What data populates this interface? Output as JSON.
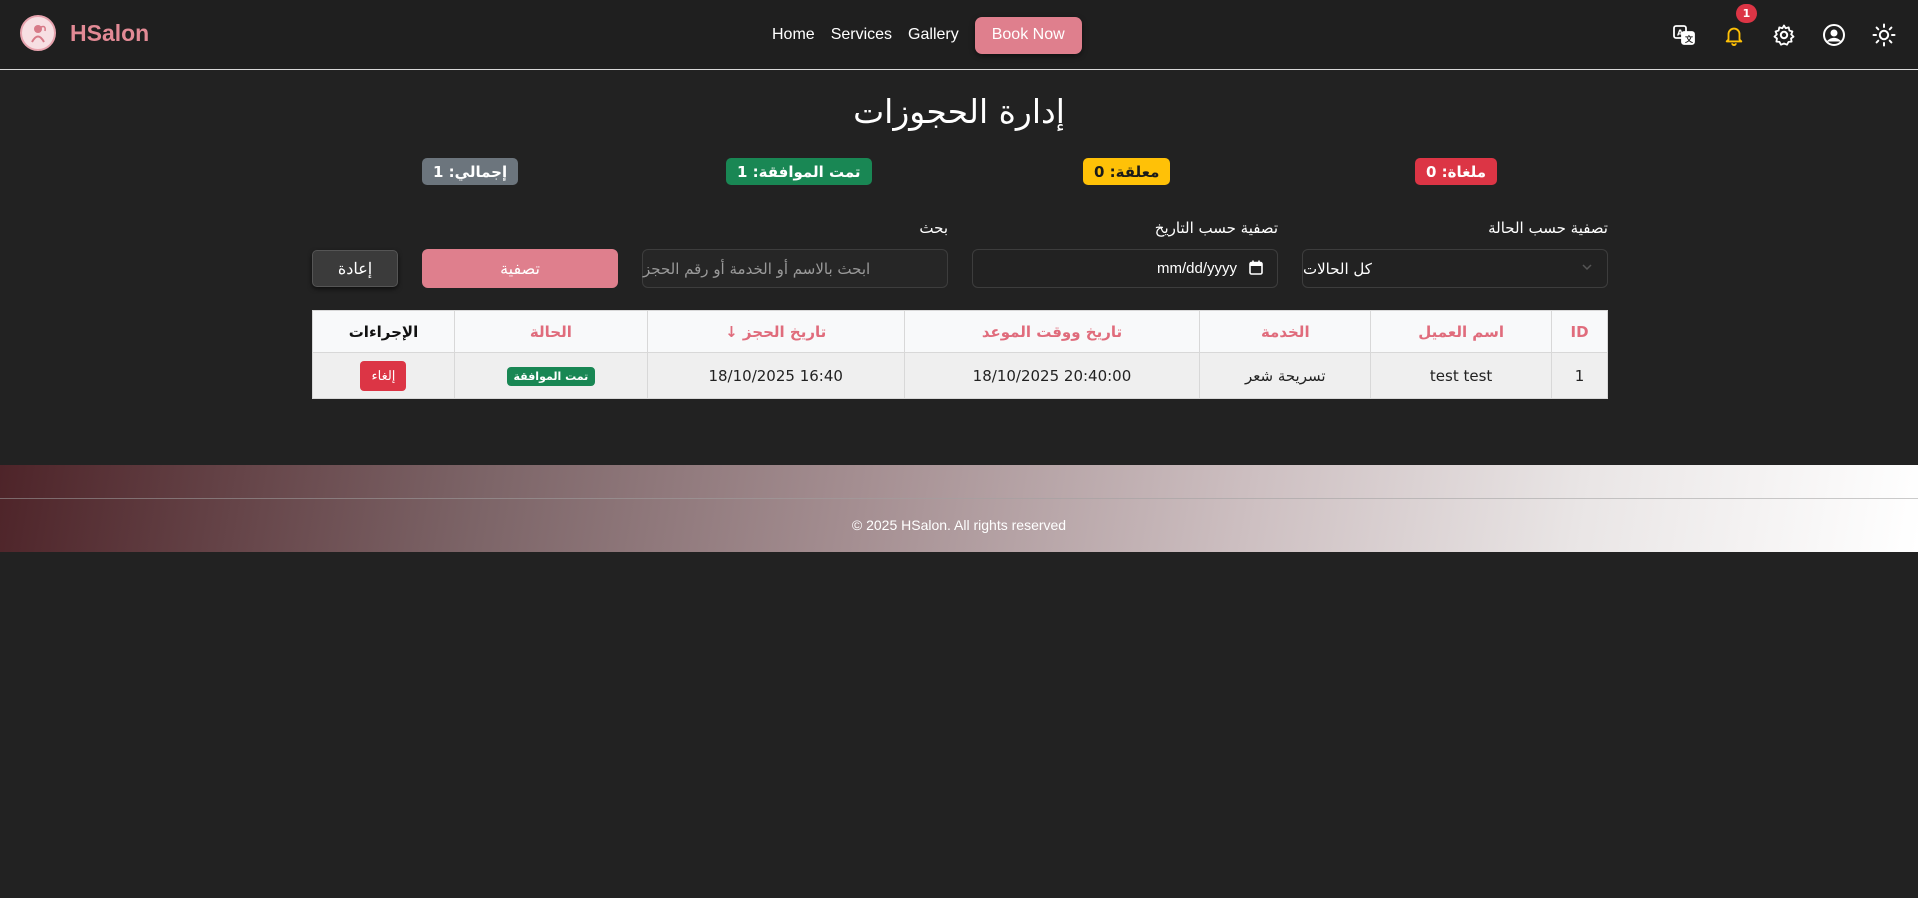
{
  "navbar": {
    "brand": "HSalon",
    "links": [
      "Home",
      "Services",
      "Gallery"
    ],
    "book_now": "Book Now",
    "icons": [
      "translate-icon",
      "bell-icon",
      "gear-icon",
      "user-circle-icon",
      "sun-icon"
    ],
    "notification_count": "1"
  },
  "page": {
    "title": "إدارة الحجوزات"
  },
  "stats": {
    "cancelled": "ملغاة: 0",
    "pending": "معلقة: 0",
    "approved": "تمت الموافقة: 1",
    "total": "إجمالي: 1"
  },
  "filters": {
    "status_label": "تصفية حسب الحالة",
    "status_value": "كل الحالات",
    "date_label": "تصفية حسب التاريخ",
    "date_placeholder": "mm/dd/yyyy",
    "search_label": "بحث",
    "search_placeholder": "ابحث بالاسم أو الخدمة أو رقم الحجز",
    "filter_button": "تصفية",
    "reset_button": "إعادة"
  },
  "table": {
    "headers": [
      "ID",
      "اسم العميل",
      "الخدمة",
      "تاريخ ووقت الموعد",
      "تاريخ الحجز ↓",
      "الحالة",
      "الإجراءات"
    ],
    "rows": [
      {
        "id": "1",
        "customer": "test test",
        "service": "تسريحة شعر",
        "appointment": "18/10/2025 20:40:00",
        "booking_date": "18/10/2025 16:40",
        "status": "تمت الموافقة",
        "action": "إلغاء"
      }
    ]
  },
  "footer": {
    "copyright": "© 2025 HSalon. All rights reserved"
  },
  "colors": {
    "accent": "#df7f8d",
    "background": "#222222",
    "success": "#198754",
    "danger": "#dc3545",
    "warning": "#ffc107",
    "secondary": "#6c757d"
  }
}
